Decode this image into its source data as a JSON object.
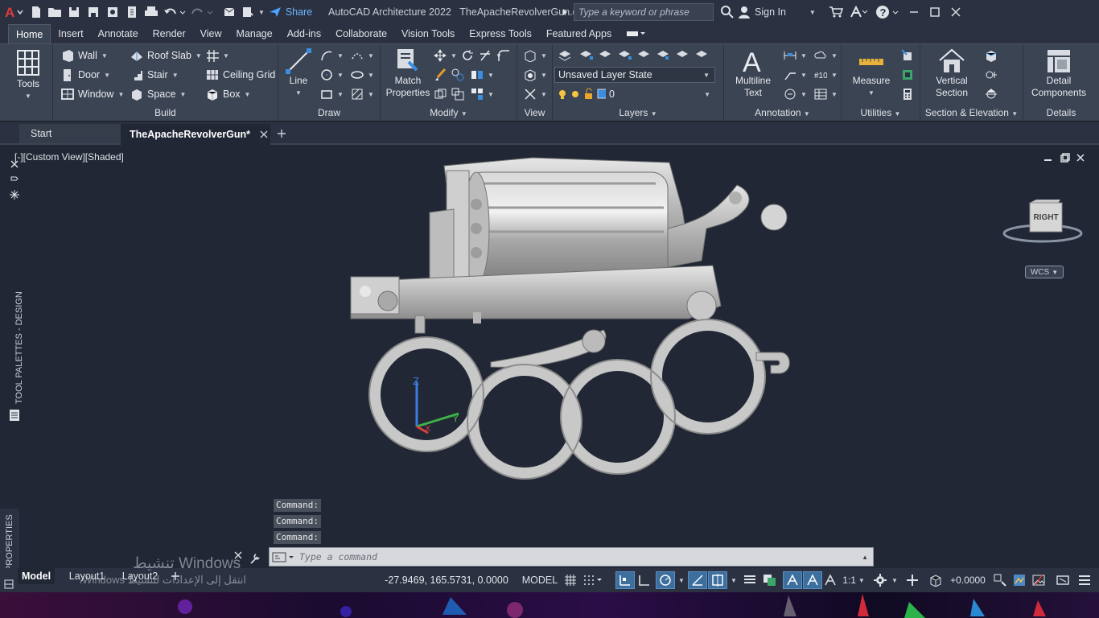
{
  "title": {
    "app_name": "AutoCAD Architecture 2022",
    "file_name": "TheApacheRevolverGun.dwg",
    "share_label": "Share",
    "search_placeholder": "Type a keyword or phrase",
    "sign_in": "Sign In"
  },
  "ribbon_tabs": [
    "Home",
    "Insert",
    "Annotate",
    "Render",
    "View",
    "Manage",
    "Add-ins",
    "Collaborate",
    "Vision Tools",
    "Express Tools",
    "Featured Apps"
  ],
  "active_tab": "Home",
  "ribbon": {
    "tools": "Tools",
    "build": {
      "title": "Build",
      "wall": "Wall",
      "door": "Door",
      "window": "Window",
      "roof_slab": "Roof Slab",
      "stair": "Stair",
      "space": "Space",
      "ceiling_grid": "Ceiling Grid",
      "box": "Box"
    },
    "draw": {
      "title": "Draw",
      "line": "Line"
    },
    "modify": {
      "title": "Modify",
      "match_properties_1": "Match",
      "match_properties_2": "Properties"
    },
    "view": {
      "title": "View"
    },
    "layers": {
      "title": "Layers",
      "layer_state": "Unsaved Layer State",
      "current_layer": "0"
    },
    "annotation": {
      "title": "Annotation",
      "mtext_1": "Multiline",
      "mtext_2": "Text"
    },
    "utilities": {
      "title": "Utilities",
      "measure": "Measure"
    },
    "section": {
      "title": "Section & Elevation",
      "vs_1": "Vertical",
      "vs_2": "Section"
    },
    "details": {
      "title": "Details",
      "dc_1": "Detail",
      "dc_2": "Components"
    }
  },
  "doc_tabs": {
    "start": "Start",
    "active": "TheApacheRevolverGun*"
  },
  "viewport": {
    "label": "[Custom View][Shaded]",
    "viewcube_face": "RIGHT",
    "wcs": "WCS",
    "tool_palettes": "TOOL PALETTES - DESIGN",
    "properties": "PROPERTIES",
    "ucs_x": "X",
    "ucs_y": "Y",
    "ucs_z": "Z"
  },
  "command": {
    "history": [
      "Command:",
      "Command:",
      "Command:"
    ],
    "placeholder": "Type  a  command"
  },
  "status": {
    "layout_tabs": [
      "Model",
      "Layout1",
      "Layout2"
    ],
    "coords": "-27.9469, 165.5731, 0.0000",
    "model": "MODEL",
    "scale": "1:1",
    "offset": "+0.0000"
  },
  "watermark": {
    "line1": "تنشيط Windows",
    "line2": "انتقل إلى الإعدادات لتنشيط Windows."
  },
  "colors": {
    "accent": "#2f7fd6",
    "panel": "#3b4453",
    "bg": "#212734"
  }
}
